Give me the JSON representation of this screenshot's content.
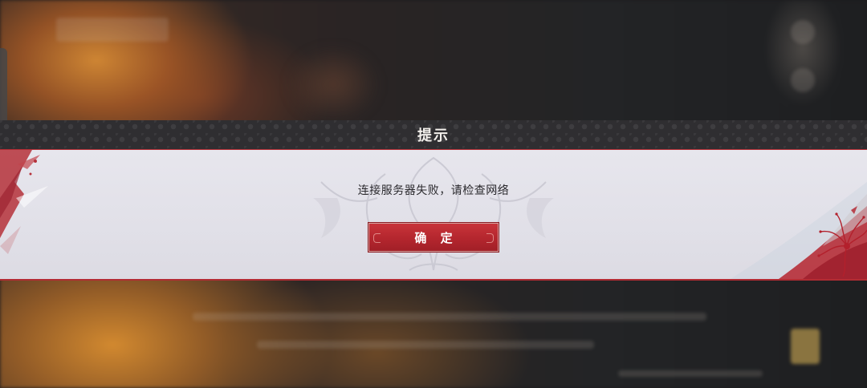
{
  "dialog": {
    "title": "提示",
    "message": "连接服务器失败，请检查网络",
    "confirm_label": "确 定"
  },
  "colors": {
    "accent_red": "#b22c33",
    "header_bg": "#2f2e31",
    "body_bg": "#e4e3ea"
  },
  "icons": {
    "emblem": "ornamental-crest-icon",
    "left_decoration": "ink-splash-icon",
    "right_decoration": "spider-lily-icon"
  }
}
